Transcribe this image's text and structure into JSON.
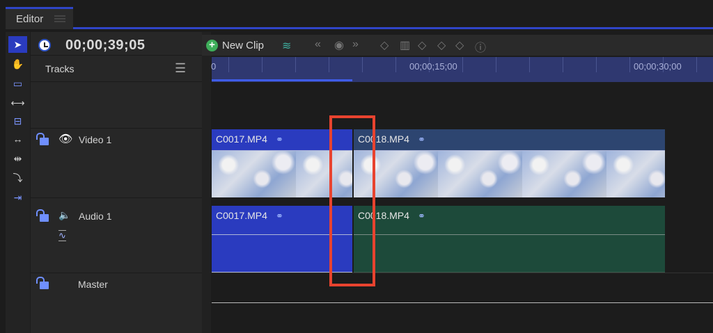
{
  "tab": {
    "title": "Editor"
  },
  "header": {
    "timecode": "00;00;39;05",
    "new_clip_label": "New Clip",
    "tracks_label": "Tracks"
  },
  "ruler": {
    "labels": [
      "0",
      "00;00;15;00",
      "00;00;30;00"
    ],
    "progress_percent": 28
  },
  "tracks": [
    {
      "name": "Video 1",
      "clips": [
        "C0017.MP4",
        "C0018.MP4"
      ]
    },
    {
      "name": "Audio 1",
      "clips": [
        "C0017.MP4",
        "C0018.MP4"
      ]
    },
    {
      "name": "Master"
    }
  ],
  "colors": {
    "accent": "#2f45c8",
    "clip_selected": "#2a3bbf",
    "video_clip": "#2d4570",
    "audio_clip": "#1d4a3a",
    "highlight": "#e8432f"
  }
}
